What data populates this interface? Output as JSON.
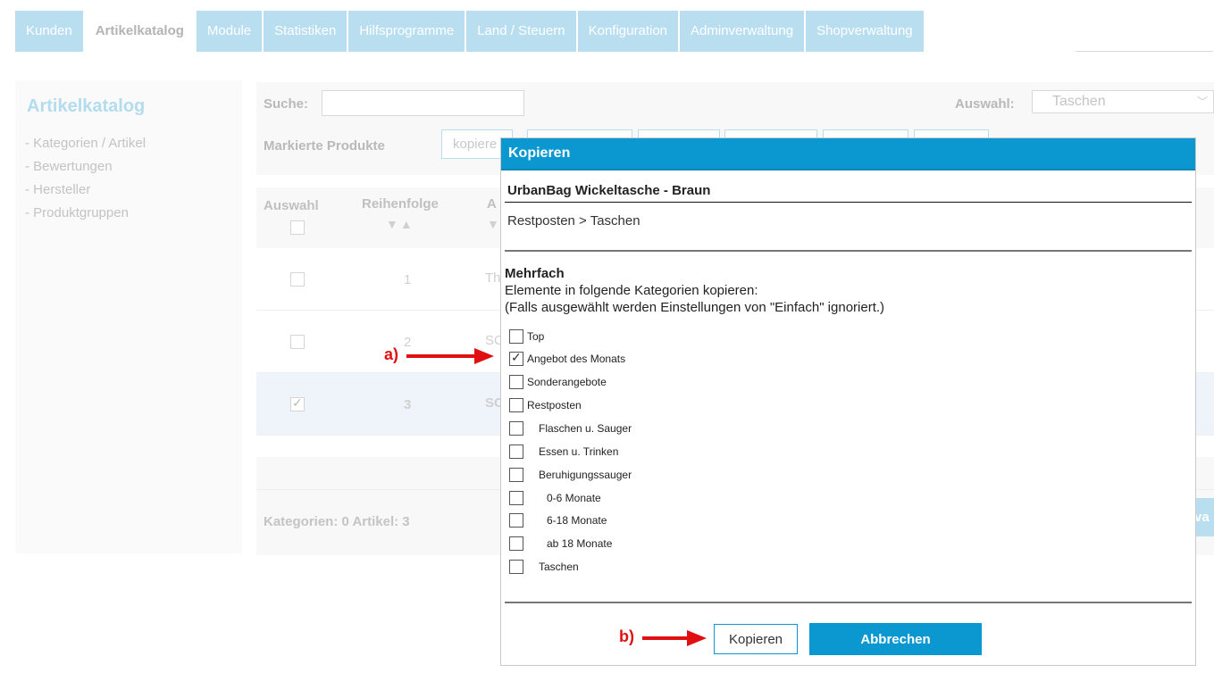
{
  "topnav": {
    "tabs": [
      {
        "label": "Kunden"
      },
      {
        "label": "Artikelkatalog"
      },
      {
        "label": "Module"
      },
      {
        "label": "Statistiken"
      },
      {
        "label": "Hilfsprogramme"
      },
      {
        "label": "Land / Steuern"
      },
      {
        "label": "Konfiguration"
      },
      {
        "label": "Adminverwaltung"
      },
      {
        "label": "Shopverwaltung"
      }
    ]
  },
  "sidebar": {
    "title": "Artikelkatalog",
    "items": [
      {
        "label": "- Kategorien / Artikel"
      },
      {
        "label": "- Bewertungen"
      },
      {
        "label": "- Hersteller"
      },
      {
        "label": "- Produktgruppen"
      }
    ]
  },
  "toolbar": {
    "search_label": "Suche:",
    "auswahl_label": "Auswahl:",
    "auswahl_value": "Taschen",
    "marked_label": "Markierte Produkte",
    "copy_btn_label": "kopiere"
  },
  "table": {
    "col_auswahl": "Auswahl",
    "col_reihenfolge": "Reihenfolge",
    "col_partial": "A",
    "rows": [
      {
        "order": "1",
        "name": "Th",
        "checked": false
      },
      {
        "order": "2",
        "name": "SC",
        "checked": false
      },
      {
        "order": "3",
        "name": "SC",
        "checked": true
      }
    ]
  },
  "footer": {
    "stats": "Kategorien: 0   Artikel: 3",
    "edge_btn": "va"
  },
  "dialog": {
    "title": "Kopieren",
    "product": "UrbanBag Wickeltasche - Braun",
    "path": "Restposten > Taschen",
    "mehrfach_title": "Mehrfach",
    "mehrfach_line1": "Elemente in folgende Kategorien kopieren:",
    "mehrfach_line2": "(Falls ausgewählt werden Einstellungen von \"Einfach\" ignoriert.)",
    "categories": [
      {
        "name": "Top",
        "checked": false
      },
      {
        "name": "Angebot des Monats",
        "checked": true
      },
      {
        "name": "Sonderangebote",
        "checked": false
      },
      {
        "name": "Restposten",
        "checked": false
      },
      {
        "name": "Flaschen u. Sauger",
        "checked": false
      },
      {
        "name": "Essen u. Trinken",
        "checked": false
      },
      {
        "name": "Beruhigungssauger",
        "checked": false
      },
      {
        "name": "0-6 Monate",
        "checked": false
      },
      {
        "name": "6-18 Monate",
        "checked": false
      },
      {
        "name": "ab 18 Monate",
        "checked": false
      },
      {
        "name": "Taschen",
        "checked": false
      }
    ],
    "copy_button": "Kopieren",
    "cancel_button": "Abbrechen"
  },
  "annotations": {
    "a": "a)",
    "b": "b)",
    "color": "#e01010"
  }
}
